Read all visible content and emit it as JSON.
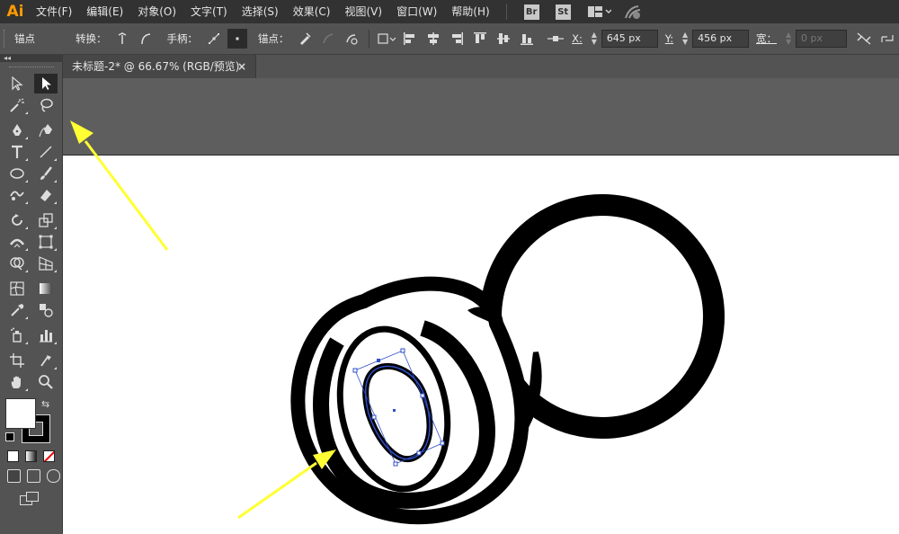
{
  "app": {
    "logo": "Ai"
  },
  "menu": [
    "文件(F)",
    "编辑(E)",
    "对象(O)",
    "文字(T)",
    "选择(S)",
    "效果(C)",
    "视图(V)",
    "窗口(W)",
    "帮助(H)"
  ],
  "app_buttons": {
    "br": "Br",
    "st": "St"
  },
  "control_bar": {
    "anchor_title": "锚点",
    "convert_label": "转换：",
    "handle_label": "手柄：",
    "anchor_label": "锚点：",
    "x_label": "X:",
    "x_value": "645 px",
    "y_label": "Y:",
    "y_value": "456 px",
    "width_label": "宽：",
    "width_value": "0 px"
  },
  "document": {
    "tab_title": "未标题-2* @ 66.67% (RGB/预览)",
    "close_glyph": "×"
  },
  "colors": {
    "highlight_arrow": "#ffff33",
    "selection": "#2f4fc9",
    "menubar": "#323232",
    "panel": "#535353",
    "logo": "#ff9a00"
  }
}
